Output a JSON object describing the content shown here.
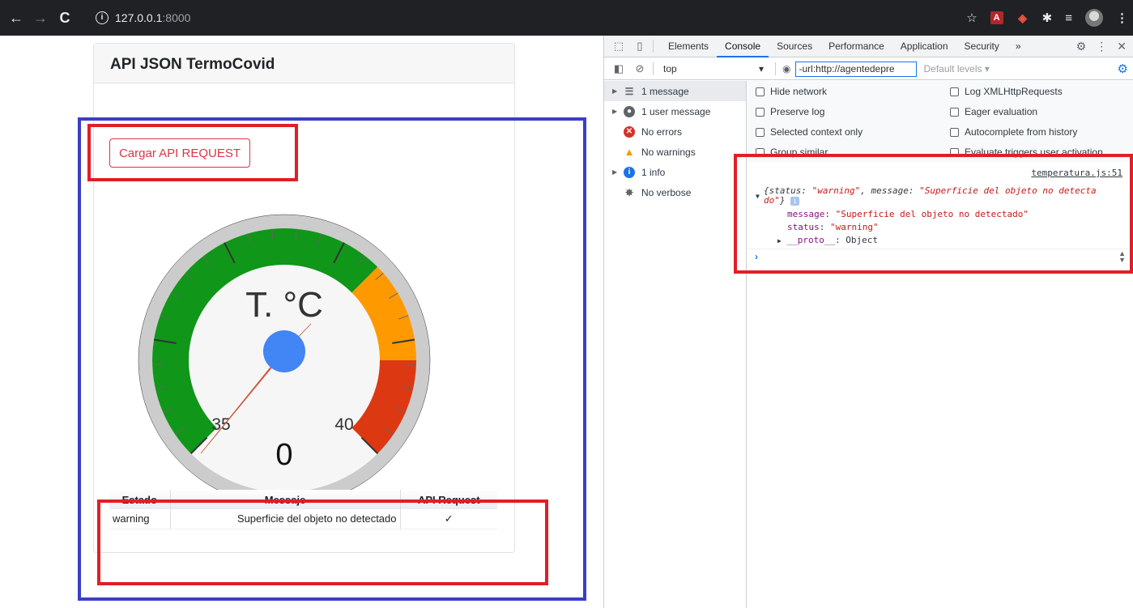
{
  "browser": {
    "url_host": "127.0.0.1",
    "url_rest": ":8000"
  },
  "page": {
    "card_title": "API JSON TermoCovid",
    "load_button_label": "Cargar API REQUEST",
    "gauge": {
      "label": "T. °C",
      "value": "0",
      "min_label": "35",
      "max_label": "40"
    },
    "table": {
      "headers": [
        "Estado",
        "Messaje",
        "API Request"
      ],
      "row": {
        "estado": "warning",
        "mensaje": "Superficie del objeto no detectado",
        "api_request": "✓"
      }
    },
    "colors": {
      "green": "#109618",
      "orange": "#FF9900",
      "red": "#DC3912",
      "needle": "#E35B3F",
      "hub": "#4285F4"
    }
  },
  "devtools": {
    "tabs": [
      "Elements",
      "Console",
      "Sources",
      "Performance",
      "Application",
      "Security"
    ],
    "more_tabs": "»",
    "active_tab": "Console",
    "context": "top",
    "filter_value": "-url:http://agentedepre",
    "levels": "Default levels ▾",
    "sidebar": [
      {
        "label": "1 message",
        "icon": "list-icon"
      },
      {
        "label": "1 user message",
        "icon": "user-icon"
      },
      {
        "label": "No errors",
        "icon": "error-icon"
      },
      {
        "label": "No warnings",
        "icon": "warning-icon"
      },
      {
        "label": "1 info",
        "icon": "info-icon"
      },
      {
        "label": "No verbose",
        "icon": "bug-icon"
      }
    ],
    "settings": {
      "hide_network": "Hide network",
      "log_xhr": "Log XMLHttpRequests",
      "preserve_log": "Preserve log",
      "eager_eval": "Eager evaluation",
      "selected_context": "Selected context only",
      "autocomplete": "Autocomplete from history",
      "group_similar": "Group similar",
      "evaluate_triggers": "Evaluate triggers user activation"
    },
    "console": {
      "source_link": "temperatura.js:51",
      "object_open": "{status: ",
      "status_val": "\"warning\"",
      "mid": ", message: ",
      "message_val": "\"Superficie del objeto no detecta",
      "message_val2": "do\"",
      "object_close": "}",
      "message_key": "message",
      "message_full": "\"Superficie del objeto no detectado\"",
      "status_key": "status",
      "status_full": "\"warning\"",
      "proto": "__proto__",
      "proto_val": ": Object",
      "prompt": "›"
    }
  }
}
